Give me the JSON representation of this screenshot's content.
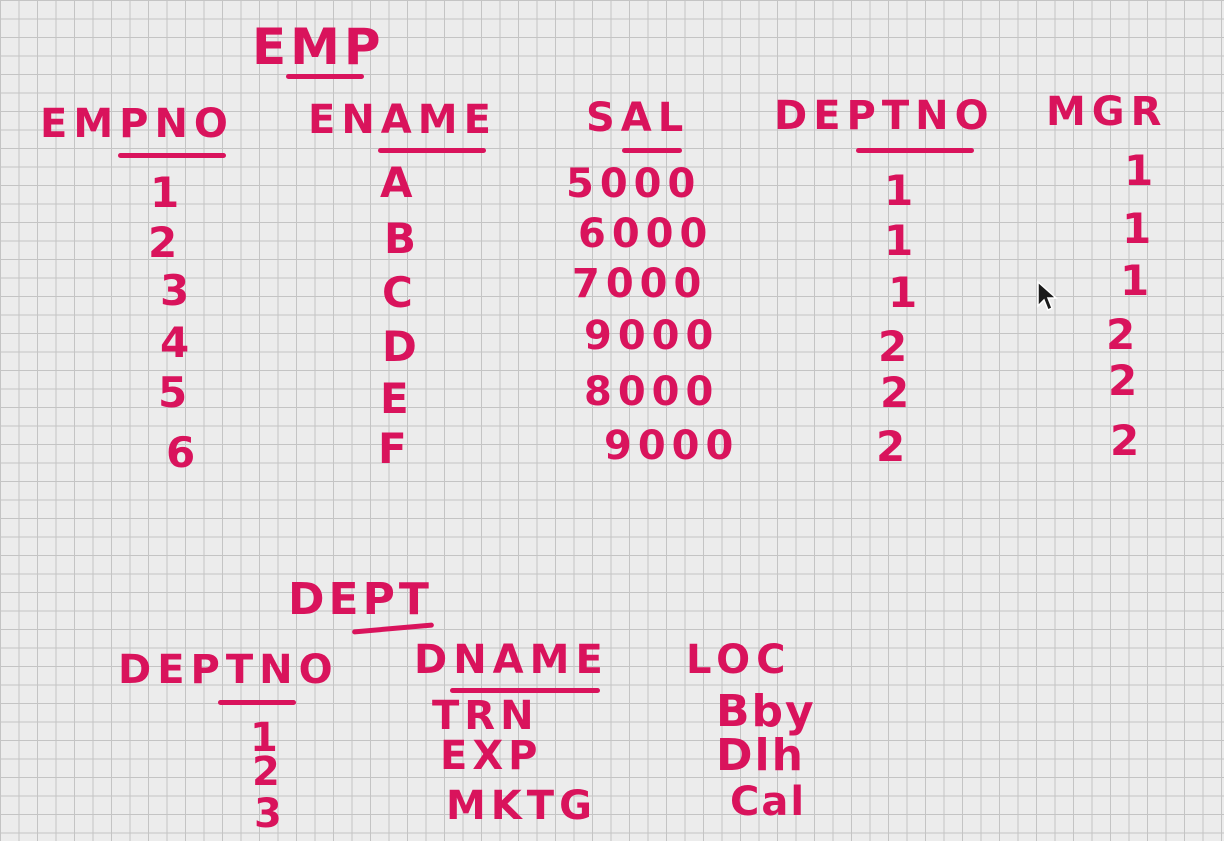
{
  "emp": {
    "title": "EMP",
    "headers": {
      "empno": "EMPNO",
      "ename": "ENAME",
      "sal": "SAL",
      "deptno": "DEPTNO",
      "mgr": "MGR"
    },
    "rows": [
      {
        "empno": "1",
        "ename": "A",
        "sal": "5000",
        "deptno": "1",
        "mgr": "1"
      },
      {
        "empno": "2",
        "ename": "B",
        "sal": "6000",
        "deptno": "1",
        "mgr": "1"
      },
      {
        "empno": "3",
        "ename": "C",
        "sal": "7000",
        "deptno": "1",
        "mgr": "1"
      },
      {
        "empno": "4",
        "ename": "D",
        "sal": "9000",
        "deptno": "2",
        "mgr": "2"
      },
      {
        "empno": "5",
        "ename": "E",
        "sal": "8000",
        "deptno": "2",
        "mgr": "2"
      },
      {
        "empno": "6",
        "ename": "F",
        "sal": "9000",
        "deptno": "2",
        "mgr": "2"
      }
    ]
  },
  "dept": {
    "title": "DEPT",
    "headers": {
      "deptno": "DEPTNO",
      "dname": "DNAME",
      "loc": "LOC"
    },
    "rows": [
      {
        "deptno": "1",
        "dname": "TRN",
        "loc": "Bby"
      },
      {
        "deptno": "2",
        "dname": "EXP",
        "loc": "Dlh"
      },
      {
        "deptno": "3",
        "dname": "MKTG",
        "loc": "Cal"
      }
    ]
  },
  "colors": {
    "ink": "#d9135c",
    "background": "#ececec",
    "grid": "#c4c4c4"
  }
}
